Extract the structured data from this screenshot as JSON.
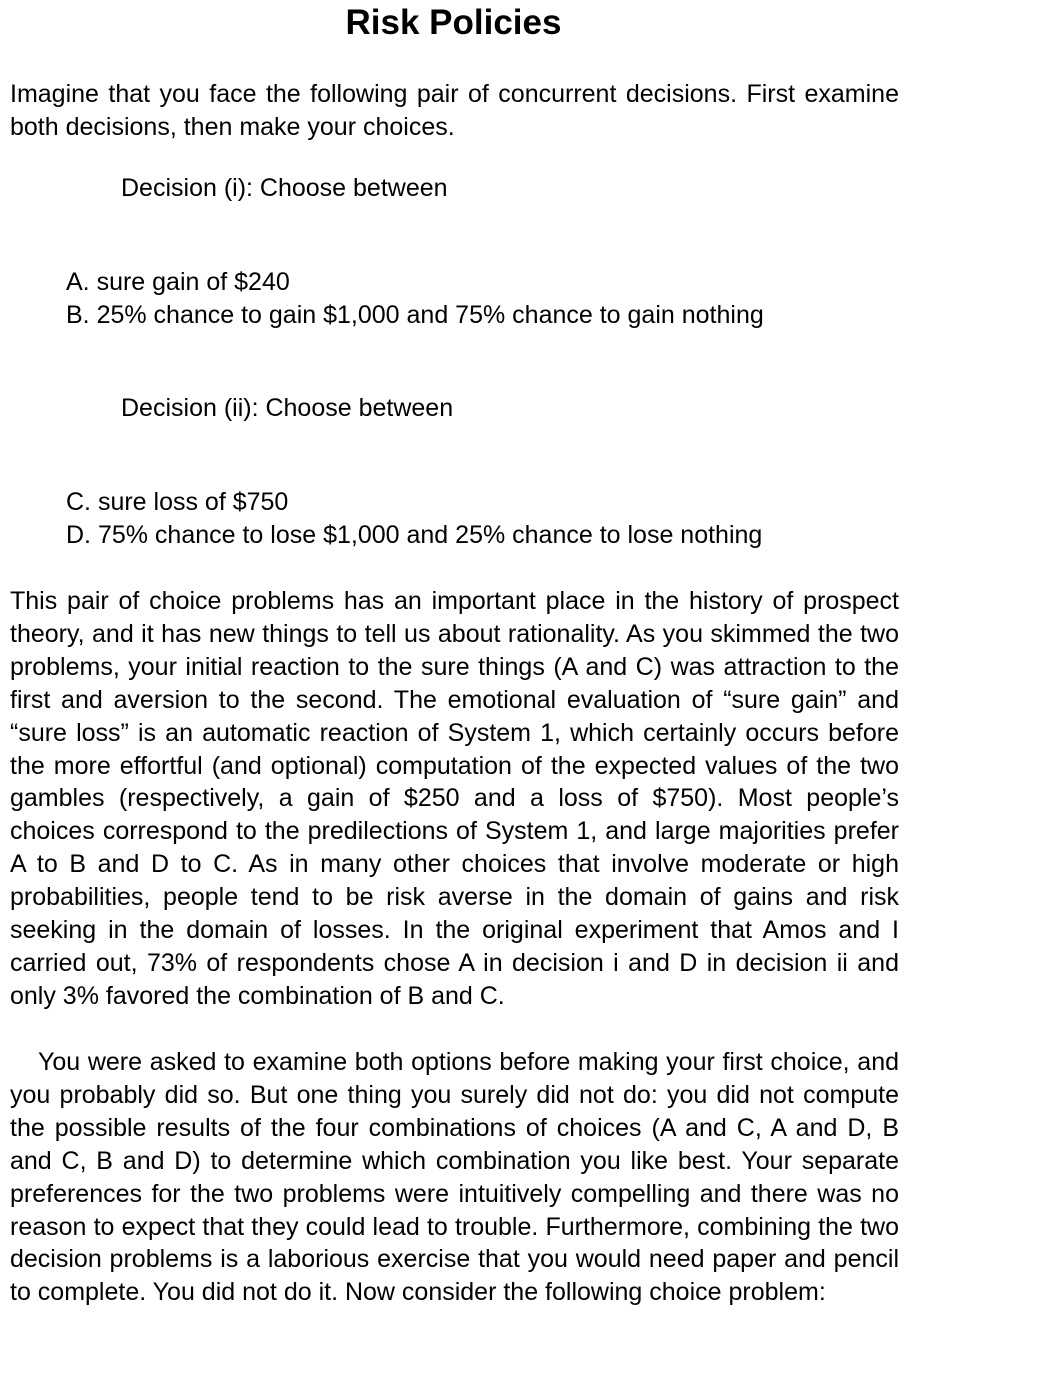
{
  "title": "Risk Policies",
  "intro": "Imagine that you face the following pair of concurrent decisions. First examine both decisions, then make your choices.",
  "decision_i": {
    "heading": "Decision (i): Choose between",
    "options": [
      "A. sure gain of $240",
      "B. 25% chance to gain $1,000 and 75% chance to gain nothing"
    ]
  },
  "decision_ii": {
    "heading": "Decision (ii): Choose between",
    "options": [
      "C. sure loss of $750",
      "D. 75% chance to lose $1,000 and 25% chance to lose nothing"
    ]
  },
  "paragraphs": [
    "This pair of choice problems has an important place in the history of prospect theory, and it has new things to tell us about rationality. As you skimmed the two problems, your initial reaction to the sure things (A and C) was attraction to the first and aversion to the second. The emotional evaluation of “sure gain” and “sure loss” is an automatic reaction of System 1, which certainly occurs before the more effortful (and optional) computation of the expected values of the two gambles (respectively, a gain of $250 and a loss of $750). Most people’s choices correspond to the predilections of System 1, and large majorities prefer A to B and D to C. As in many other choices that involve moderate or high probabilities, people tend to be risk averse in the domain of gains and risk seeking in the domain of losses. In the original experiment that Amos and I carried out, 73% of respondents chose A in decision i and D in decision ii and only 3% favored the combination of B and C.",
    "You were asked to examine both options before making your first choice, and you probably did so. But one thing you surely did not do: you did not compute the possible results of the four combinations of choices (A and C, A and D, B and C, B and D) to determine which combination you like best. Your separate preferences for the two problems were intuitively compelling and there was no reason to expect that they could lead to trouble. Furthermore, combining the two decision problems is a laborious exercise that you would need paper and pencil to complete. You did not do it. Now consider the following choice problem:"
  ]
}
